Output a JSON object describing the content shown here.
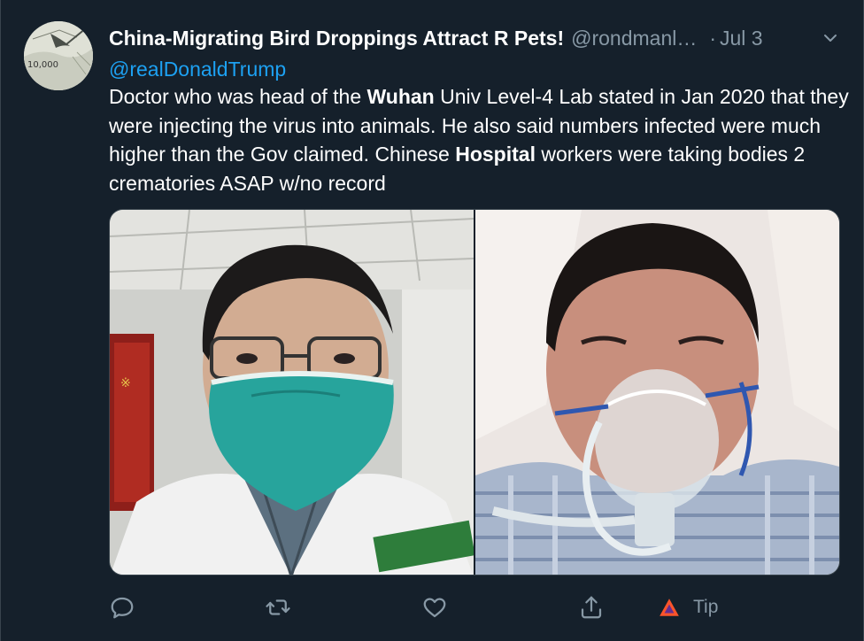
{
  "tweet": {
    "author": {
      "display_name": "China-Migrating Bird Droppings Attract R Pets!",
      "handle": "@rondmanl…",
      "avatar_icon": "map-avatar",
      "avatar_text": "10,000"
    },
    "separator": "·",
    "date": "Jul 3",
    "menu_icon": "chevron-down-icon",
    "reply_to": "@realDonaldTrump",
    "body": {
      "p1": "Doctor who was head of the ",
      "b1": "Wuhan",
      "p2": " Univ Level-4 Lab stated in Jan 2020 that they were injecting the virus into animals.  He also said numbers infected were much higher than the Gov claimed. Chinese ",
      "b2": "Hospital",
      "p3": " workers were taking bodies 2 crematories ASAP w/no record"
    },
    "media": [
      {
        "description_icon": "photo-masked-doctor"
      },
      {
        "description_icon": "photo-patient-oxygen-mask"
      }
    ],
    "actions": {
      "reply_icon": "reply-icon",
      "retweet_icon": "retweet-icon",
      "like_icon": "heart-icon",
      "share_icon": "share-icon",
      "tip_icon": "tip-icon",
      "tip_label": "Tip"
    }
  },
  "colors": {
    "background": "#15202b",
    "text": "#ffffff",
    "secondary": "#8899a6",
    "accent": "#1da1f2",
    "border": "#38444d"
  }
}
